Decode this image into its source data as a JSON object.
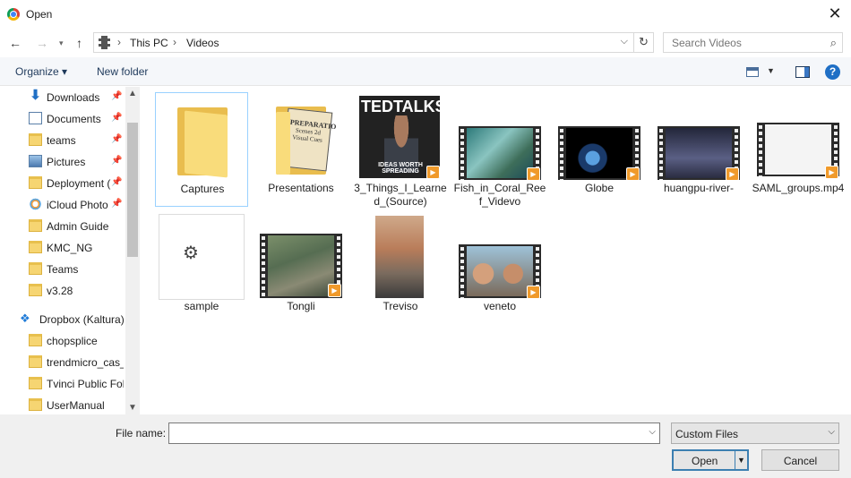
{
  "window": {
    "title": "Open"
  },
  "address": {
    "path": [
      "This PC",
      "Videos"
    ]
  },
  "search": {
    "placeholder": "Search Videos"
  },
  "toolbar": {
    "organize": "Organize ▾",
    "new_folder": "New folder",
    "help": "?"
  },
  "sidebar": {
    "items": [
      {
        "label": "Downloads",
        "icon": "download-icon",
        "pinned": true
      },
      {
        "label": "Documents",
        "icon": "documents-icon",
        "pinned": true
      },
      {
        "label": "teams",
        "icon": "folder-icon",
        "pinned": true
      },
      {
        "label": "Pictures",
        "icon": "pictures-icon",
        "pinned": true
      },
      {
        "label": "Deployment (",
        "icon": "folder-icon",
        "pinned": true
      },
      {
        "label": "iCloud Photo",
        "icon": "icloud-photos-icon",
        "pinned": true
      },
      {
        "label": "Admin Guide",
        "icon": "folder-icon",
        "pinned": false
      },
      {
        "label": "KMC_NG",
        "icon": "folder-icon",
        "pinned": false
      },
      {
        "label": "Teams",
        "icon": "folder-icon",
        "pinned": false
      },
      {
        "label": "v3.28",
        "icon": "folder-icon",
        "pinned": false
      },
      {
        "label": "Dropbox (Kaltura)",
        "icon": "dropbox-icon",
        "pinned": false
      },
      {
        "label": "chopsplice",
        "icon": "shared-folder-icon",
        "pinned": false
      },
      {
        "label": "trendmicro_cas_",
        "icon": "shared-folder-icon",
        "pinned": false
      },
      {
        "label": "Tvinci Public Fol",
        "icon": "shared-folder-icon",
        "pinned": false
      },
      {
        "label": "UserManual",
        "icon": "synced-folder-icon",
        "pinned": false
      }
    ]
  },
  "files": [
    {
      "name": "Captures",
      "kind": "folder"
    },
    {
      "name": "Presentations",
      "kind": "folder",
      "preview_title": "PREPARATIO",
      "preview_text": "Scenes 2d Visual Cues"
    },
    {
      "name": "3_Things_I_Learned_(Source)",
      "kind": "video",
      "preview_text": "TEDTALKS",
      "preview_tag": "IDEAS WORTH SPREADING"
    },
    {
      "name": "Fish_in_Coral_Reef_Videvo",
      "kind": "video"
    },
    {
      "name": "Globe",
      "kind": "video"
    },
    {
      "name": "huangpu-river-",
      "kind": "video"
    },
    {
      "name": "SAML_groups.mp4",
      "kind": "video"
    },
    {
      "name": "sample",
      "kind": "file"
    },
    {
      "name": "Tongli",
      "kind": "video"
    },
    {
      "name": "Treviso",
      "kind": "video"
    },
    {
      "name": "veneto",
      "kind": "video"
    }
  ],
  "footer": {
    "file_name_label": "File name:",
    "file_name_value": "",
    "filter": "Custom Files",
    "open": "Open",
    "cancel": "Cancel"
  }
}
